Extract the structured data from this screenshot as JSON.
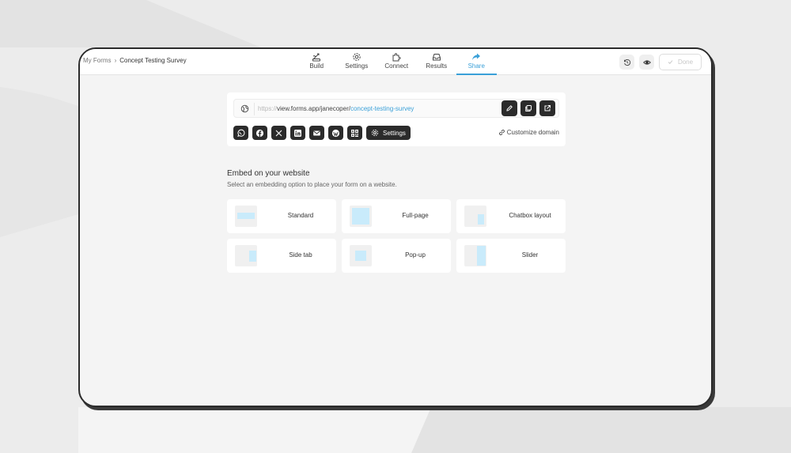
{
  "colors": {
    "accent": "#3aa0d8",
    "dark": "#2b2b2b",
    "thumb_fill": "#c9ebfb"
  },
  "breadcrumb": {
    "root": "My Forms",
    "separator": "›",
    "current": "Concept Testing Survey"
  },
  "nav": {
    "tabs": [
      {
        "label": "Build",
        "icon": "build-icon",
        "active": false
      },
      {
        "label": "Settings",
        "icon": "gear-icon",
        "active": false
      },
      {
        "label": "Connect",
        "icon": "puzzle-icon",
        "active": false
      },
      {
        "label": "Results",
        "icon": "inbox-icon",
        "active": false
      },
      {
        "label": "Share",
        "icon": "share-icon",
        "active": true
      }
    ]
  },
  "toolbar": {
    "history_icon": "history-icon",
    "preview_icon": "eye-icon",
    "done_label": "Done"
  },
  "share": {
    "url_protocol": "https://",
    "url_base": "view.forms.app/janecoper/",
    "url_slug": "concept-testing-survey",
    "url_actions": [
      "edit-icon",
      "copy-icon",
      "external-link-icon"
    ],
    "social": [
      "whatsapp-icon",
      "facebook-icon",
      "x-icon",
      "linkedin-icon",
      "email-icon",
      "wordpress-icon",
      "qr-code-icon"
    ],
    "settings_label": "Settings",
    "customize_label": "Customize domain"
  },
  "embed": {
    "title": "Embed on your website",
    "subtitle": "Select an embedding option to place your form on a website.",
    "options": [
      {
        "label": "Standard"
      },
      {
        "label": "Full-page"
      },
      {
        "label": "Chatbox layout"
      },
      {
        "label": "Side tab"
      },
      {
        "label": "Pop-up"
      },
      {
        "label": "Slider"
      }
    ]
  }
}
